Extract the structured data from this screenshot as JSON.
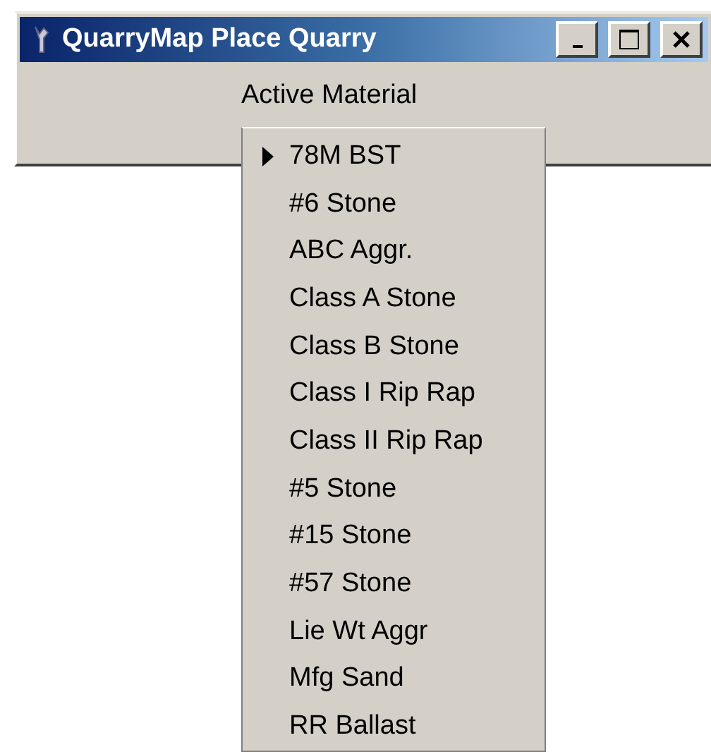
{
  "window": {
    "title": "QuarryMap Place Quarry"
  },
  "label": "Active Material",
  "materials": [
    {
      "name": "78M BST",
      "selected": true
    },
    {
      "name": "#6 Stone",
      "selected": false
    },
    {
      "name": "ABC Aggr.",
      "selected": false
    },
    {
      "name": "Class A Stone",
      "selected": false
    },
    {
      "name": "Class B Stone",
      "selected": false
    },
    {
      "name": "Class I Rip Rap",
      "selected": false
    },
    {
      "name": "Class II Rip Rap",
      "selected": false
    },
    {
      "name": "#5 Stone",
      "selected": false
    },
    {
      "name": "#15 Stone",
      "selected": false
    },
    {
      "name": "#57 Stone",
      "selected": false
    },
    {
      "name": "Lie Wt Aggr",
      "selected": false
    },
    {
      "name": "Mfg Sand",
      "selected": false
    },
    {
      "name": "RR Ballast",
      "selected": false
    }
  ]
}
